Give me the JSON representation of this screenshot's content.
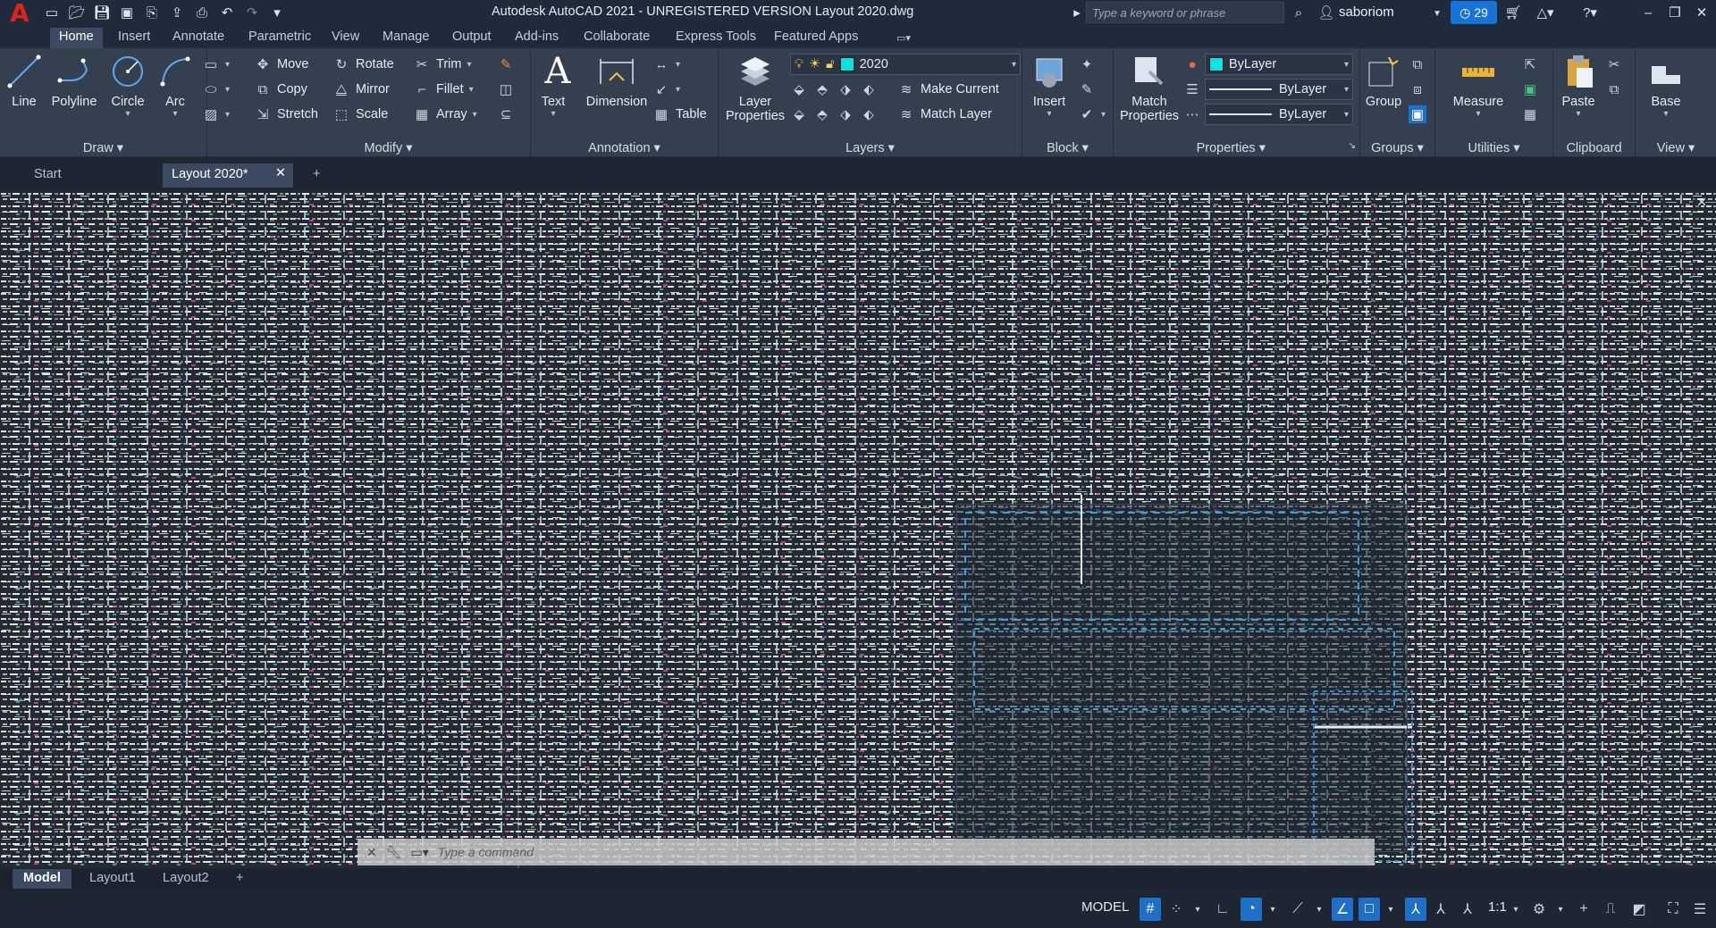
{
  "window": {
    "title": "Autodesk AutoCAD 2021 - UNREGISTERED VERSION    Layout 2020.dwg",
    "search_placeholder": "Type a keyword or phrase",
    "user": "saboriom",
    "notification_count": "29"
  },
  "ribbon_tabs": [
    "Home",
    "Insert",
    "Annotate",
    "Parametric",
    "View",
    "Manage",
    "Output",
    "Add-ins",
    "Collaborate",
    "Express Tools",
    "Featured Apps"
  ],
  "draw": {
    "title": "Draw",
    "line": "Line",
    "polyline": "Polyline",
    "circle": "Circle",
    "arc": "Arc"
  },
  "modify": {
    "title": "Modify",
    "move": "Move",
    "rotate": "Rotate",
    "trim": "Trim",
    "copy": "Copy",
    "mirror": "Mirror",
    "fillet": "Fillet",
    "stretch": "Stretch",
    "scale": "Scale",
    "array": "Array"
  },
  "annotation": {
    "title": "Annotation",
    "text": "Text",
    "dimension": "Dimension",
    "table": "Table"
  },
  "layers": {
    "title": "Layers",
    "layer_properties": "Layer Properties",
    "current_layer": "2020",
    "make_current": "Make Current",
    "match_layer": "Match Layer"
  },
  "block": {
    "title": "Block",
    "insert": "Insert"
  },
  "properties": {
    "title": "Properties",
    "match_properties": "Match Properties",
    "color": "ByLayer",
    "linetype": "ByLayer",
    "lineweight": "ByLayer"
  },
  "groups": {
    "title": "Groups",
    "group": "Group"
  },
  "utilities": {
    "title": "Utilities",
    "measure": "Measure"
  },
  "clipboard": {
    "title": "Clipboard",
    "paste": "Paste"
  },
  "view_panel": {
    "title": "View",
    "base": "Base"
  },
  "doc_tabs": [
    "Start",
    "Layout 2020*"
  ],
  "command_line": {
    "placeholder": "Type a command"
  },
  "layout_tabs": [
    "Model",
    "Layout1",
    "Layout2"
  ],
  "status": {
    "model": "MODEL",
    "scale": "1:1"
  },
  "colors": {
    "accent": "#1673d8",
    "layer_swatch": "#00e5e5",
    "logo": "#d9251d"
  }
}
